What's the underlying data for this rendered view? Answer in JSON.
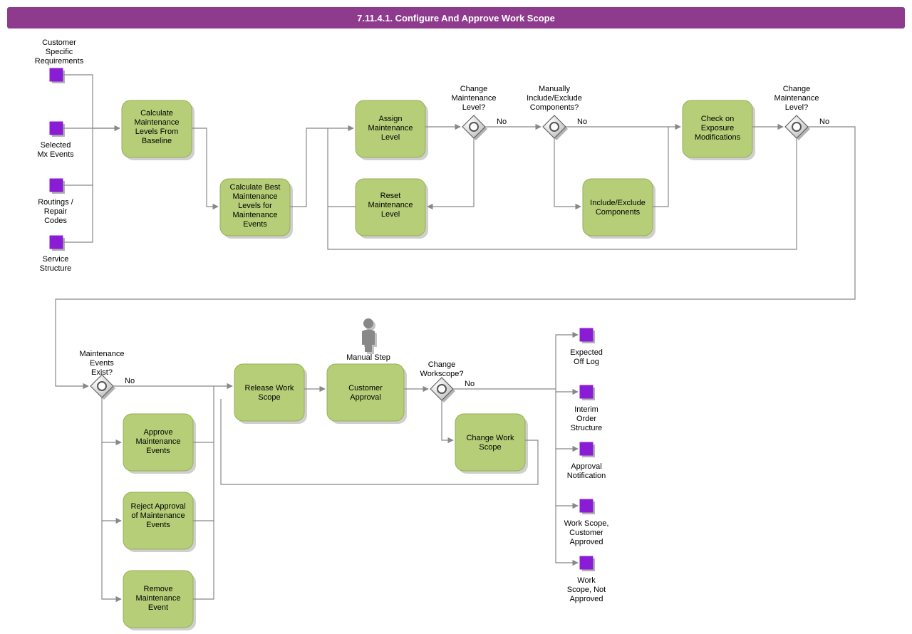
{
  "title": "7.11.4.1. Configure And Approve Work Scope",
  "inputs": {
    "customerReq": "Customer\nSpecific\nRequirements",
    "selectedMx": "Selected\nMx Events",
    "routings": "Routings /\nRepair\nCodes",
    "serviceStructure": "Service\nStructure"
  },
  "tasks": {
    "calcBaseline": "Calculate\nMaintenance\nLevels From\nBaseline",
    "calcBest": "Calculate Best\nMaintenance\nLevels for\nMaintenance\nEvents",
    "assignMx": "Assign\nMaintenance\nLevel",
    "resetMx": "Reset\nMaintenance\nLevel",
    "incExc": "Include/Exclude\nComponents",
    "checkExp": "Check on\nExposure\nModifications",
    "approveMx": "Approve\nMaintenance\nEvents",
    "rejectMx": "Reject Approval\nof Maintenance\nEvents",
    "removeMx": "Remove\nMaintenance\nEvent",
    "releaseWS": "Release Work\nScope",
    "custApproval": "Customer\nApproval",
    "changeWS": "Change Work\nScope"
  },
  "gateways": {
    "changeMx1": "Change\nMaintenance\nLevel?",
    "manualIncExc": "Manually\nInclude/Exclude\nComponents?",
    "changeMx2": "Change\nMaintenance\nLevel?",
    "mxEventsExist": "Maintenance\nEvents\nExist?",
    "changeWorkscope": "Change\nWorkscope?"
  },
  "edgeLabels": {
    "no": "No"
  },
  "manualStep": "Manual Step",
  "outputs": {
    "expectedOffLog": "Expected\nOff Log",
    "interimOrder": "Interim\nOrder\nStructure",
    "approvalNotif": "Approval\nNotification",
    "wsApproved": "Work Scope,\nCustomer\nApproved",
    "wsNotApproved": "Work\nScope, Not\nApproved"
  }
}
